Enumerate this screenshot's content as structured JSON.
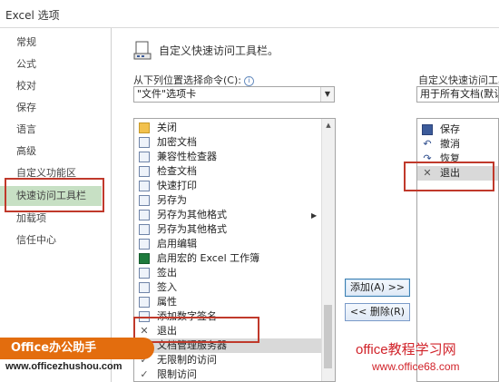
{
  "window": {
    "title": "Excel 选项"
  },
  "sidebar": {
    "items": [
      {
        "label": "常规"
      },
      {
        "label": "公式"
      },
      {
        "label": "校对"
      },
      {
        "label": "保存"
      },
      {
        "label": "语言"
      },
      {
        "label": "高级"
      },
      {
        "label": "自定义功能区"
      },
      {
        "label": "快速访问工具栏",
        "selected": true
      },
      {
        "label": "加载项"
      },
      {
        "label": "信任中心"
      }
    ]
  },
  "header": {
    "title": "自定义快速访问工具栏。"
  },
  "left": {
    "choose_label": "从下列位置选择命令(C):",
    "choose_value": "\"文件\"选项卡",
    "commands": [
      {
        "label": "关闭",
        "icon": "folder-icon"
      },
      {
        "label": "加密文档",
        "icon": "lock-document-icon"
      },
      {
        "label": "兼容性检查器",
        "icon": "document-check-icon"
      },
      {
        "label": "检查文档",
        "icon": "document-inspect-icon"
      },
      {
        "label": "快速打印",
        "icon": "print-icon"
      },
      {
        "label": "另存为",
        "icon": "save-as-icon"
      },
      {
        "label": "另存为其他格式",
        "icon": "save-as-icon"
      },
      {
        "label": "另存为其他格式",
        "icon": "save-as-icon"
      },
      {
        "label": "启用编辑",
        "icon": "edit-document-icon"
      },
      {
        "label": "启用宏的 Excel 工作簿",
        "icon": "excel-icon"
      },
      {
        "label": "签出",
        "icon": "check-out-icon"
      },
      {
        "label": "签入",
        "icon": "check-in-icon"
      },
      {
        "label": "属性",
        "icon": "properties-icon"
      },
      {
        "label": "添加数字签名",
        "icon": "signature-icon"
      },
      {
        "label": "退出",
        "icon": "close-x-icon"
      },
      {
        "label": "文档管理服务器",
        "icon": "server-icon"
      },
      {
        "label": "无限制的访问",
        "icon": "check-icon"
      },
      {
        "label": "限制访问",
        "icon": "check-icon"
      }
    ]
  },
  "right": {
    "customize_label": "自定义快速访问工具",
    "customize_value": "用于所有文档(默认",
    "items": [
      {
        "label": "保存",
        "icon": "save-icon"
      },
      {
        "label": "撤消",
        "icon": "undo-icon"
      },
      {
        "label": "恢复",
        "icon": "redo-icon"
      },
      {
        "label": "退出",
        "icon": "close-x-icon"
      }
    ]
  },
  "buttons": {
    "add": "添加(A) >>",
    "remove": "<< 删除(R)"
  },
  "watermark": {
    "left_badge": "Office办公助手",
    "left_url": "www.officezhushou.com",
    "right_title": "office教程学习网",
    "right_url": "www.office68.com"
  },
  "colors": {
    "selection": "#c7e0c4",
    "highlight_box": "#c0392b",
    "watermark_orange": "#e36d0e",
    "watermark_red": "#d1232a"
  }
}
